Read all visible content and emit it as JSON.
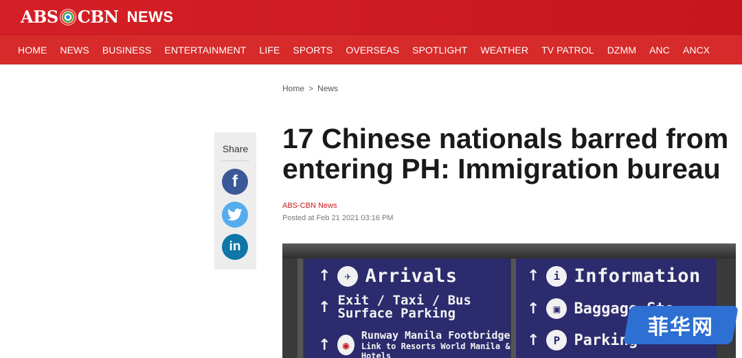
{
  "brand": {
    "logo_left": "ABS",
    "logo_right": "CBN",
    "logo_suffix": "NEWS",
    "accent": "#d51f26"
  },
  "nav": {
    "items": [
      "HOME",
      "NEWS",
      "BUSINESS",
      "ENTERTAINMENT",
      "LIFE",
      "SPORTS",
      "OVERSEAS",
      "SPOTLIGHT",
      "WEATHER",
      "TV PATROL",
      "DZMM",
      "ANC",
      "ANCX"
    ]
  },
  "breadcrumb": {
    "home": "Home",
    "separator": ">",
    "current": "News"
  },
  "share": {
    "label": "Share",
    "buttons": [
      {
        "name": "facebook",
        "glyph": "f",
        "color": "#3b5998"
      },
      {
        "name": "twitter",
        "color": "#55acee"
      },
      {
        "name": "linkedin",
        "glyph": "in",
        "color": "#0e76a8"
      }
    ]
  },
  "article": {
    "headline_line1": "17 Chinese nationals barred from",
    "headline_line2": "entering PH: Immigration bureau",
    "source": "ABS-CBN News",
    "posted": "Posted at Feb 21 2021 03:16 PM"
  },
  "photo": {
    "sign_left": {
      "row1": "Arrivals",
      "row2a": "Exit / Taxi / Bus",
      "row2b": "Surface Parking",
      "row3a": "Runway Manila Footbridge",
      "row3b": "Link to Resorts World Manila & Hotels"
    },
    "sign_right": {
      "row1": "Information",
      "row2": "Baggage Sto",
      "row3": "Parking"
    },
    "arrow": "↑",
    "info_glyph": "i",
    "parking_glyph": "P"
  },
  "watermark": {
    "text": "菲华网"
  }
}
